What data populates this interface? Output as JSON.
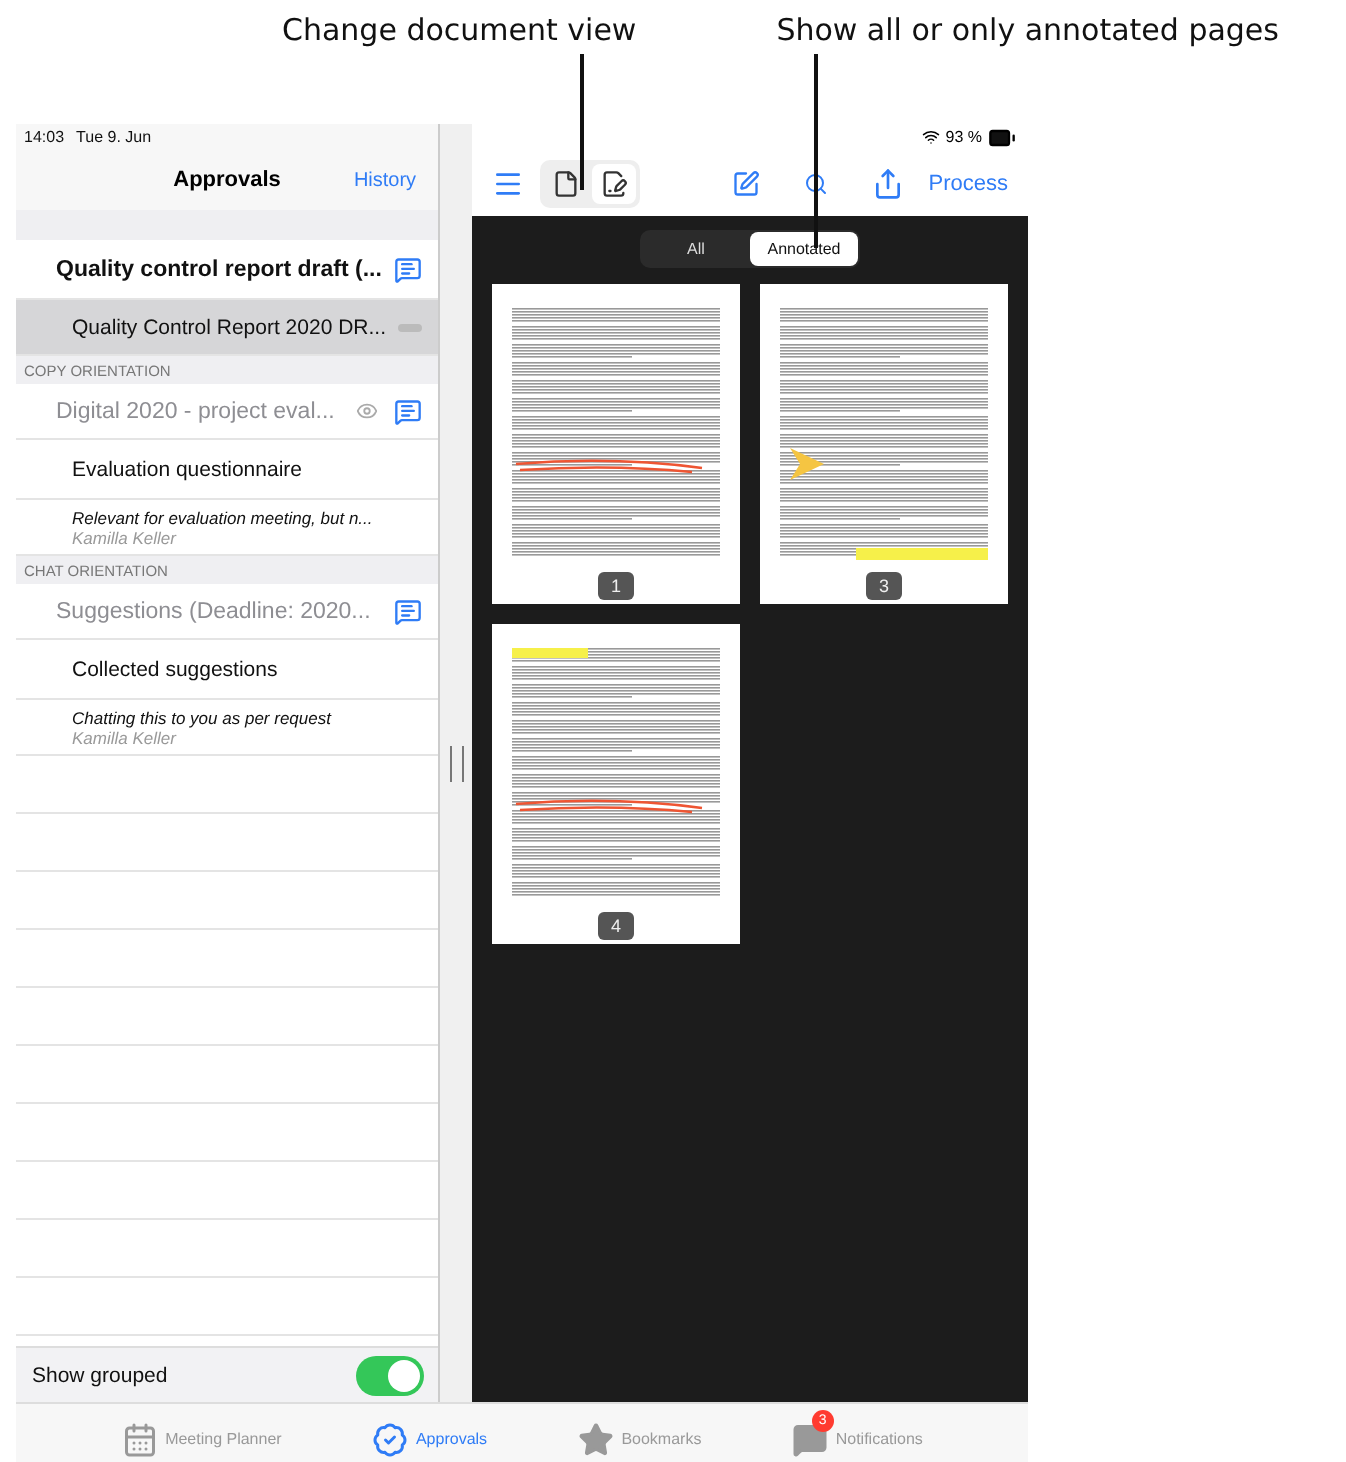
{
  "callouts": [
    {
      "text": "Change document view"
    },
    {
      "text": "Show all or only annotated pages"
    }
  ],
  "status_bar": {
    "time": "14:03",
    "date": "Tue 9. Jun",
    "battery": "93 %"
  },
  "sidebar": {
    "title": "Approvals",
    "history_button": "History",
    "rows": [
      {
        "kind": "document",
        "title": "Quality control report draft (...",
        "dimmed": false,
        "viewed": false
      },
      {
        "kind": "attachment",
        "title": "Quality Control Report 2020 DR...",
        "selected": true
      },
      {
        "kind": "section",
        "label": "COPY ORIENTATION"
      },
      {
        "kind": "document",
        "title": "Digital 2020 - project eval...",
        "dimmed": true,
        "viewed": true
      },
      {
        "kind": "attachment",
        "title": "Evaluation questionnaire",
        "selected": false
      },
      {
        "kind": "comment",
        "text": "Relevant for evaluation meeting, but n...",
        "author": "Kamilla Keller"
      },
      {
        "kind": "section",
        "label": "CHAT ORIENTATION"
      },
      {
        "kind": "document",
        "title": "Suggestions (Deadline: 2020...",
        "dimmed": true,
        "viewed": false
      },
      {
        "kind": "attachment",
        "title": "Collected suggestions",
        "selected": false
      },
      {
        "kind": "comment",
        "text": "Chatting this to you as per request",
        "author": "Kamilla Keller"
      }
    ],
    "toggle": {
      "label": "Show grouped",
      "on": true
    }
  },
  "toolbar": {
    "view_modes": [
      {
        "kind": "page",
        "selected": false
      },
      {
        "kind": "annotate",
        "selected": true
      }
    ],
    "process_button": "Process"
  },
  "filter": [
    {
      "label": "All",
      "selected": false
    },
    {
      "label": "Annotated",
      "selected": true
    }
  ],
  "pages": [
    {
      "number": "1",
      "strikethrough": true,
      "highlight": false,
      "arrow": false
    },
    {
      "number": "3",
      "strikethrough": false,
      "highlight": true,
      "arrow": true
    },
    {
      "number": "4",
      "strikethrough": true,
      "highlight": true,
      "arrow": false
    }
  ],
  "tab_bar": [
    {
      "kind": "calendar",
      "label": "Meeting Planner",
      "selected": false
    },
    {
      "kind": "approvals",
      "label": "Approvals",
      "selected": true
    },
    {
      "kind": "star",
      "label": "Bookmarks",
      "selected": false
    },
    {
      "kind": "chat",
      "label": "Notifications",
      "selected": false,
      "badge": "3"
    }
  ]
}
